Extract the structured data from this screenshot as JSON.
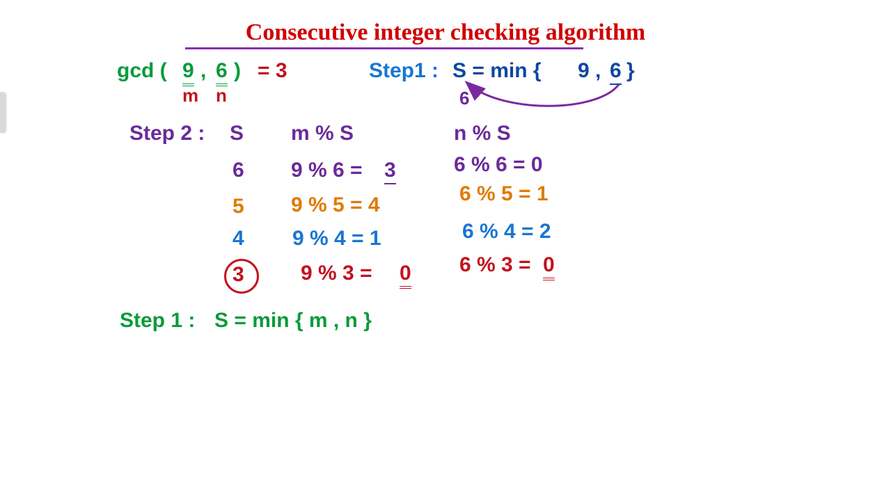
{
  "title": "Consecutive integer checking algorithm",
  "gcd": {
    "func": "gcd (",
    "m": "9",
    "comma": ",",
    "n": "6",
    "close": ")",
    "eq": "= 3"
  },
  "mn": {
    "m": "m",
    "n": "n"
  },
  "step1_top": {
    "label": "Step1 :",
    "expr_a": "S = min {",
    "expr_b": "9 , ",
    "expr_c": "6",
    "expr_d": "}",
    "val": "6"
  },
  "step2": {
    "label": "Step 2 :",
    "head_s": "S",
    "head_ms": "m % S",
    "head_ns": "n % S",
    "r1": {
      "s": "6",
      "ms_a": "9 % 6 =",
      "ms_b": "3",
      "ns": "6 % 6 = 0"
    },
    "r2": {
      "s": "5",
      "ms": "9 % 5 = 4",
      "ns": "6 % 5 = 1"
    },
    "r3": {
      "s": "4",
      "ms": "9 % 4 = 1",
      "ns": "6 % 4 = 2"
    },
    "r4": {
      "s": "3",
      "ms_a": "9 % 3 =",
      "ms_b": "0",
      "ns_a": "6 % 3 =",
      "ns_b": "0"
    }
  },
  "step1_bottom": {
    "label": "Step 1 :",
    "expr": "S = min { m , n }"
  }
}
